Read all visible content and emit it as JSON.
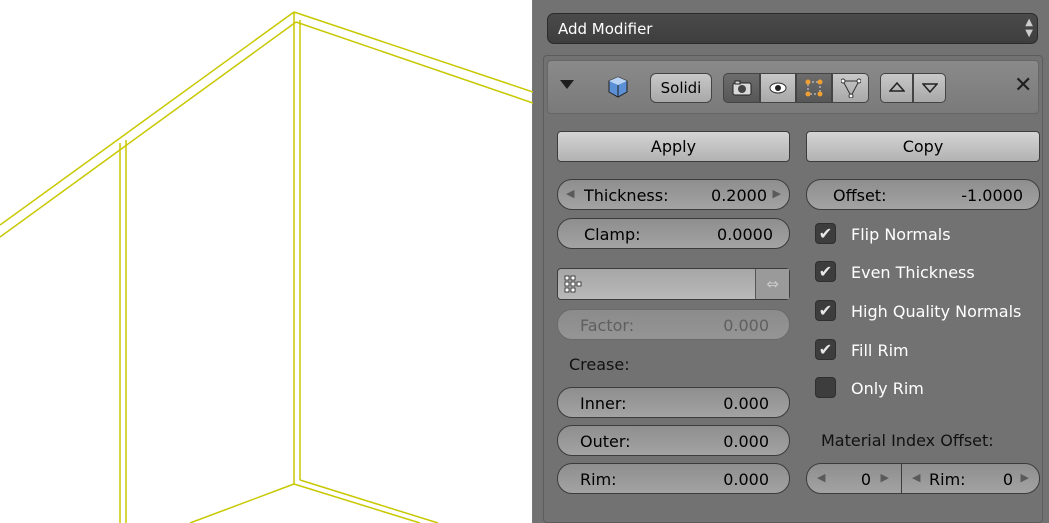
{
  "header": {
    "add_modifier": "Add Modifier",
    "modifier_name": "Solidi",
    "icons": [
      "collapse-triangle-icon",
      "solidify-modifier-icon",
      "render-camera-icon",
      "eye-visibility-icon",
      "editmode-icon",
      "cage-vertices-icon",
      "move-up-icon",
      "move-down-icon",
      "close-icon"
    ]
  },
  "actions": {
    "apply": "Apply",
    "copy": "Copy"
  },
  "left": {
    "thickness_label": "Thickness:",
    "thickness_value": "0.2000",
    "clamp_label": "Clamp:",
    "clamp_value": "0.0000",
    "vertex_group_value": "",
    "factor_label": "Factor:",
    "factor_value": "0.000",
    "crease_label": "Crease:",
    "inner_label": "Inner:",
    "inner_value": "0.000",
    "outer_label": "Outer:",
    "outer_value": "0.000",
    "rim_label": "Rim:",
    "rim_value": "0.000"
  },
  "right": {
    "offset_label": "Offset:",
    "offset_value": "-1.0000",
    "checkboxes": [
      {
        "label": "Flip Normals",
        "checked": true
      },
      {
        "label": "Even Thickness",
        "checked": true
      },
      {
        "label": "High Quality Normals",
        "checked": true
      },
      {
        "label": "Fill Rim",
        "checked": true
      },
      {
        "label": "Only Rim",
        "checked": false
      }
    ],
    "material_index_offset_label": "Material Index Offset:",
    "material_value": "0",
    "material_rim_label": "Rim:",
    "material_rim_value": "0"
  },
  "colors": {
    "wireframe": "#c8c800",
    "panel": "#727272"
  }
}
